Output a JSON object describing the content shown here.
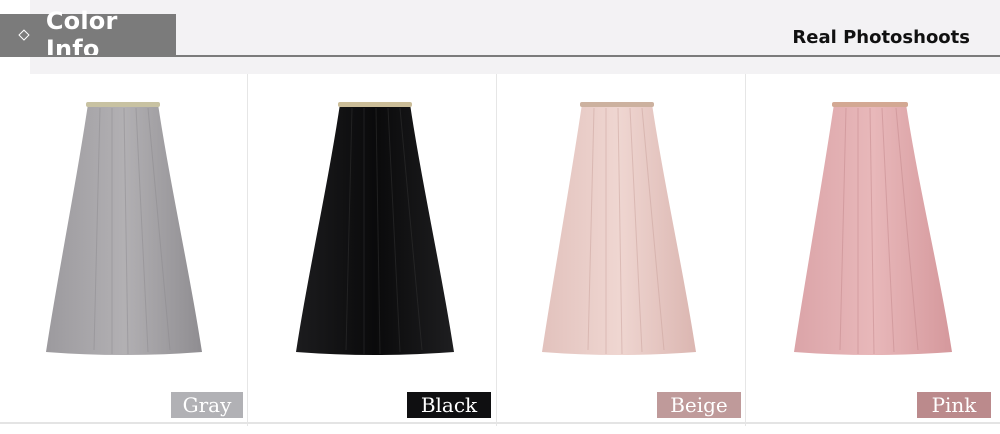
{
  "header": {
    "title": "Color Info",
    "subtitle": "Real Photoshoots"
  },
  "colors": [
    {
      "name": "Gray",
      "label_bg": "#b1b1b5",
      "fabric": "#a7a5a8",
      "fabric_dark": "#8c8a8e",
      "band": "#c8c0a0"
    },
    {
      "name": "Black",
      "label_bg": "#0f0f11",
      "fabric": "#161618",
      "fabric_dark": "#000000",
      "band": "#c7b99a"
    },
    {
      "name": "Beige",
      "label_bg": "#bf9a9a",
      "fabric": "#e8cbc5",
      "fabric_dark": "#d7b0aa",
      "band": "#c9ae9c"
    },
    {
      "name": "Pink",
      "label_bg": "#bb8a8c",
      "fabric": "#e4aeb0",
      "fabric_dark": "#d08f94",
      "band": "#cfa68f"
    }
  ]
}
